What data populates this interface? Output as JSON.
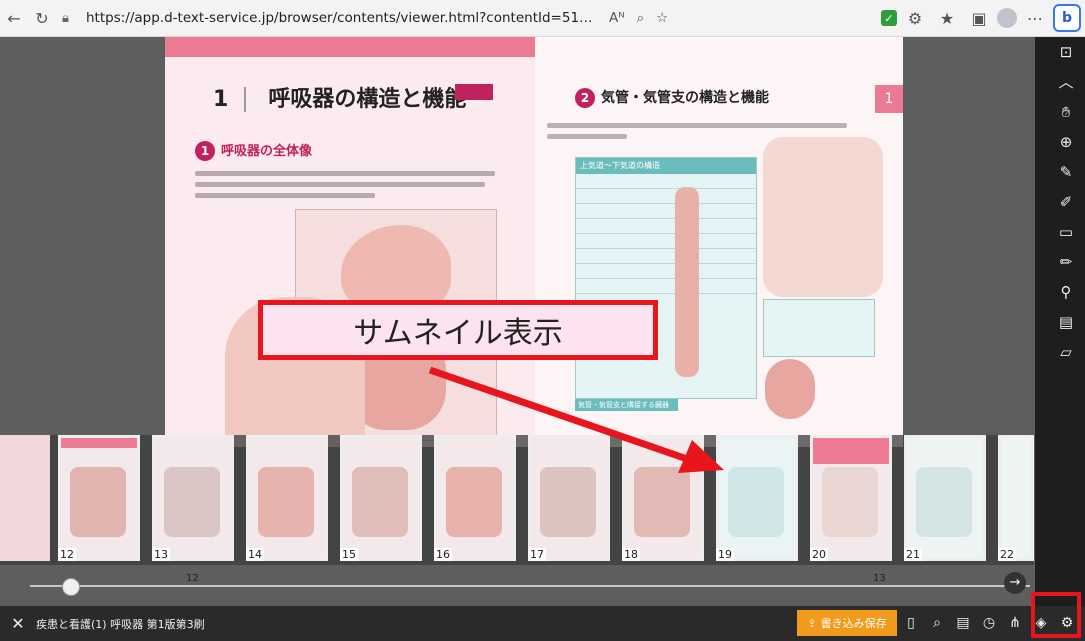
{
  "browser": {
    "url": "https://app.d-text-service.jp/browser/contents/viewer.html?contentId=51433&misc=Af...",
    "read_aloud": "Aᴺ"
  },
  "pages": {
    "left": {
      "chapter_number": "1",
      "title": "呼吸器の構造と機能",
      "section_number": "1",
      "section_title": "呼吸器の全体像",
      "page_number": "12"
    },
    "right": {
      "section_number": "2",
      "section_title": "気管・気管支の構造と機能",
      "side_tab": "1",
      "table_title": "上気道〜下気道の構造",
      "lower_section": "気管・気管支と隣接する臓器",
      "page_number": "13"
    }
  },
  "callout": {
    "text": "サムネイル表示"
  },
  "thumbnails": [
    {
      "num": "12"
    },
    {
      "num": "13"
    },
    {
      "num": "14"
    },
    {
      "num": "15"
    },
    {
      "num": "16"
    },
    {
      "num": "17"
    },
    {
      "num": "18"
    },
    {
      "num": "19"
    },
    {
      "num": "20"
    },
    {
      "num": "21"
    },
    {
      "num": "22"
    }
  ],
  "bottombar": {
    "close": "✕",
    "title": "疾患と看護(1)  呼吸器 第1版第3刷",
    "save_label": "書き込み保存"
  },
  "colors": {
    "accent_pink": "#ec7a92",
    "brand_magenta": "#c0225d",
    "save_orange": "#f29a1c",
    "highlight_red": "#e8161c"
  }
}
